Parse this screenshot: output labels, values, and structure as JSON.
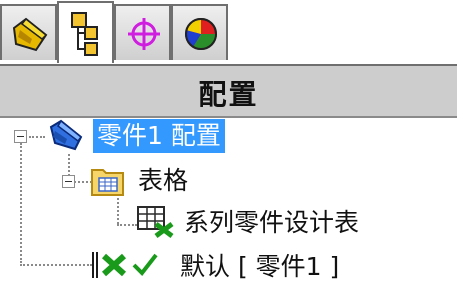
{
  "tabs": [
    {
      "icon": "feature-manager-icon"
    },
    {
      "icon": "property-manager-icon"
    },
    {
      "icon": "configuration-manager-icon"
    },
    {
      "icon": "display-manager-icon"
    }
  ],
  "header": {
    "title": "配置"
  },
  "tree": {
    "root": {
      "label": "零件1 配置",
      "icon": "part-config-icon",
      "selected": true
    },
    "tables": {
      "label": "表格",
      "icon": "table-folder-icon"
    },
    "design_table": {
      "label": "系列零件设计表",
      "icon": "design-table-icon"
    },
    "default_config": {
      "label": "默认 [ 零件1 ]",
      "icon": "config-check-icon"
    }
  },
  "colors": {
    "selection": "#3399ff",
    "header_bg": "#cdcdcd",
    "accent_green": "#1a9a1a"
  }
}
